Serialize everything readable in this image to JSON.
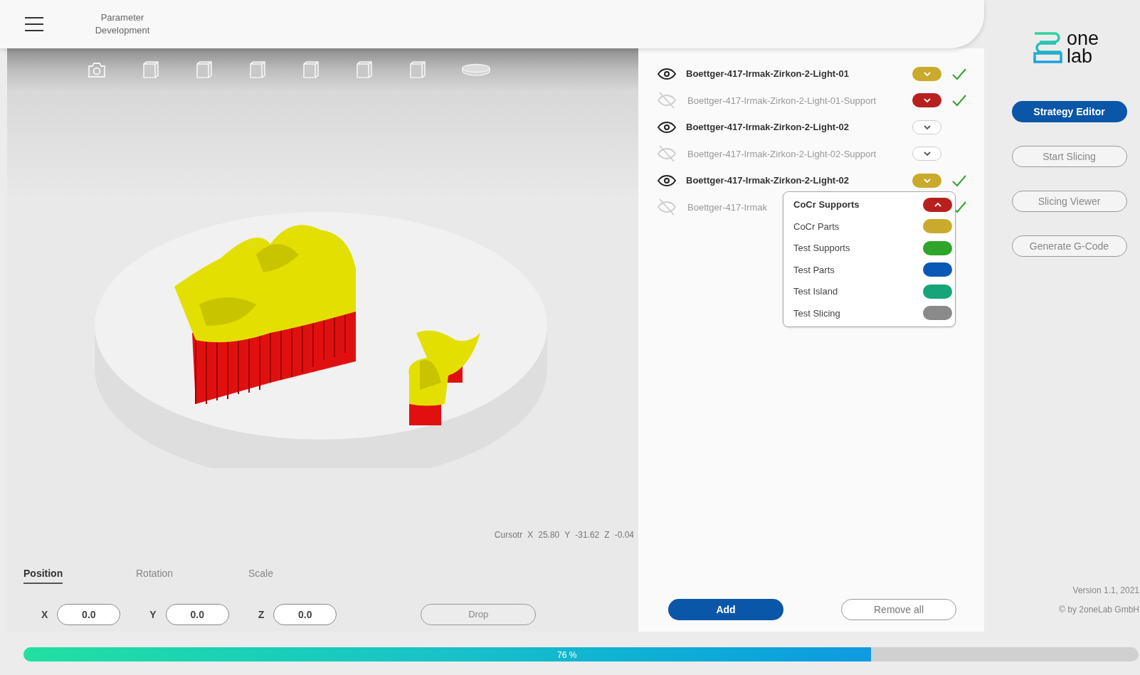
{
  "header": {
    "title": "Parameter Development"
  },
  "toolbar": [
    {
      "kind": "camera"
    },
    {
      "kind": "cube"
    },
    {
      "kind": "cube"
    },
    {
      "kind": "cube"
    },
    {
      "kind": "cube"
    },
    {
      "kind": "cube"
    },
    {
      "kind": "cube"
    },
    {
      "kind": "plate"
    }
  ],
  "cursor": [
    "Cursotr",
    "X",
    "25.80",
    "Y",
    "-31.62",
    "Z",
    "-0.04"
  ],
  "transform_tabs": [
    {
      "label": "Position",
      "selected": true
    },
    {
      "label": "Rotation",
      "selected": false
    },
    {
      "label": "Scale",
      "selected": false
    }
  ],
  "fields": [
    {
      "label": "X",
      "value": "0.0"
    },
    {
      "label": "Y",
      "value": "0.0"
    },
    {
      "label": "Z",
      "value": "0.0"
    }
  ],
  "drop_button": "Drop",
  "objects": [
    {
      "name": "Boettger-417-Irmak-Zirkon-2-Light-01",
      "visible": true,
      "color": "#c9aa2c",
      "checked": true,
      "expanded": false
    },
    {
      "name": "Boettger-417-Irmak-Zirkon-2-Light-01-Support",
      "visible": false,
      "color": "#b8201e",
      "checked": true,
      "expanded": false
    },
    {
      "name": "Boettger-417-Irmak-Zirkon-2-Light-02",
      "visible": true,
      "checked": false,
      "expanded": false
    },
    {
      "name": "Boettger-417-Irmak-Zirkon-2-Light-02-Support",
      "visible": false,
      "checked": false,
      "expanded": false
    },
    {
      "name": "Boettger-417-Irmak-Zirkon-2-Light-02",
      "visible": true,
      "color": "#c9aa2c",
      "checked": true,
      "expanded": false
    },
    {
      "name": "Boettger-417-Irmak",
      "visible": false,
      "checked": true,
      "expanded": true
    }
  ],
  "strategy_options": [
    {
      "label": "CoCr Supports",
      "color": "#b8201e",
      "selected": true
    },
    {
      "label": "CoCr Parts",
      "color": "#c9aa2c",
      "selected": false
    },
    {
      "label": "Test Supports",
      "color": "#2fa52a",
      "selected": false
    },
    {
      "label": "Test Parts",
      "color": "#0a58b5",
      "selected": false
    },
    {
      "label": "Test Island",
      "color": "#16a57a",
      "selected": false
    },
    {
      "label": "Test Slicing",
      "color": "#8a8a8a",
      "selected": false
    }
  ],
  "list_buttons": [
    "Add",
    "Remove all"
  ],
  "logo": [
    "one",
    "lab"
  ],
  "actions": [
    {
      "label": "Strategy Editor",
      "primary": true
    },
    {
      "label": "Start Slicing",
      "primary": false
    },
    {
      "label": "Slicing Viewer",
      "primary": false
    },
    {
      "label": "Generate G-Code",
      "primary": false
    }
  ],
  "footer": [
    "Version 1.1, 2021",
    "© by 2oneLab GmbH"
  ],
  "progress": {
    "level": 0.76,
    "label": "76 %"
  }
}
